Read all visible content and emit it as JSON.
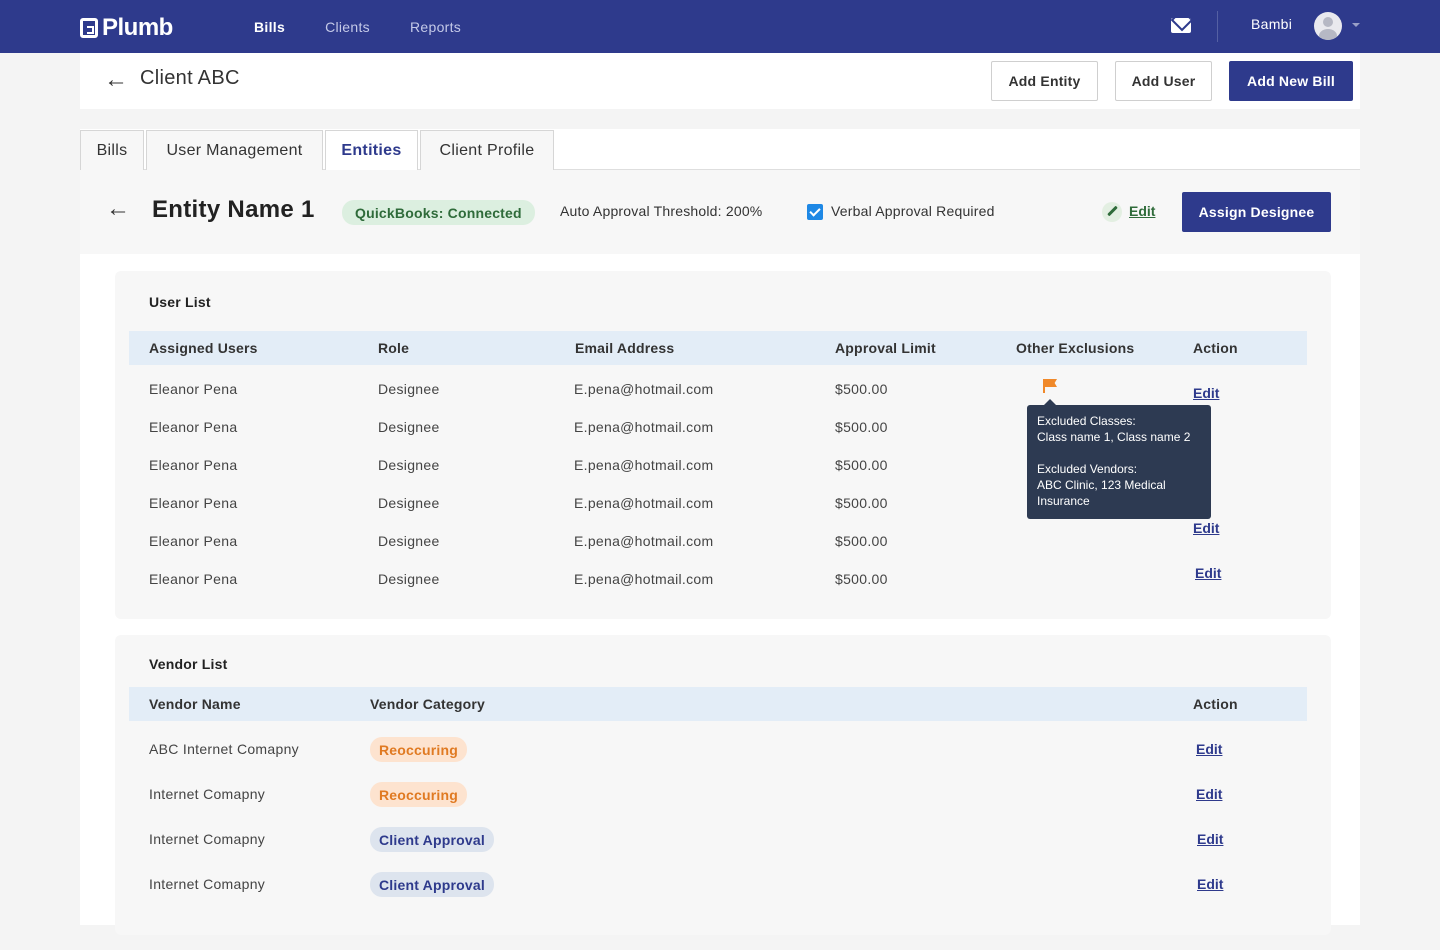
{
  "app": {
    "logo": "Plumb"
  },
  "nav": {
    "links": [
      "Bills",
      "Clients",
      "Reports"
    ],
    "active": "Bills",
    "user_name": "Bambi"
  },
  "client": {
    "title": "Client ABC",
    "add_entity": "Add Entity",
    "add_user": "Add User",
    "add_bill": "Add New Bill"
  },
  "tabs": [
    "Bills",
    "User Management",
    "Entities",
    "Client Profile"
  ],
  "entity": {
    "name": "Entity Name 1",
    "quickbooks": "QuickBooks: Connected",
    "threshold": "Auto Approval Threshold: 200%",
    "verbal_checked": true,
    "verbal": "Verbal Approval Required",
    "edit": "Edit",
    "assign": "Assign Designee"
  },
  "user_list": {
    "title": "User List",
    "headers": [
      "Assigned Users",
      "Role",
      "Email Address",
      "Approval Limit",
      "Other Exclusions",
      "Action"
    ],
    "rows": [
      {
        "name": "Eleanor Pena",
        "role": "Designee",
        "email": "E.pena@hotmail.com",
        "limit": "$500.00",
        "action": "Edit"
      },
      {
        "name": "Eleanor Pena",
        "role": "Designee",
        "email": "E.pena@hotmail.com",
        "limit": "$500.00",
        "action": "it"
      },
      {
        "name": "Eleanor Pena",
        "role": "Designee",
        "email": "E.pena@hotmail.com",
        "limit": "$500.00",
        "action": "it"
      },
      {
        "name": "Eleanor Pena",
        "role": "Designee",
        "email": "E.pena@hotmail.com",
        "limit": "$500.00",
        "action": "Edit"
      },
      {
        "name": "Eleanor Pena",
        "role": "Designee",
        "email": "E.pena@hotmail.com",
        "limit": "$500.00",
        "action": ""
      },
      {
        "name": "Eleanor Pena",
        "role": "Designee",
        "email": "E.pena@hotmail.com",
        "limit": "$500.00",
        "action": "Edit"
      }
    ],
    "tooltip": {
      "classes_label": "Excluded Classes:",
      "classes": "Class name 1, Class name 2",
      "vendors_label": "Excluded Vendors:",
      "vendors_line1": "ABC Clinic, 123 Medical",
      "vendors_line2": "Insurance"
    }
  },
  "vendor_list": {
    "title": "Vendor List",
    "headers": [
      "Vendor Name",
      "Vendor Category",
      "Action"
    ],
    "rows": [
      {
        "name": "ABC Internet Comapny",
        "category": "Reoccuring",
        "category_color": "#e07a22",
        "action": "Edit"
      },
      {
        "name": "Internet Comapny",
        "category": "Reoccuring",
        "category_color": "#e07a22",
        "action": "Edit"
      },
      {
        "name": "Internet Comapny",
        "category": "Client Approval",
        "category_color": "#2e3a8c",
        "action": "Edit"
      },
      {
        "name": "Internet Comapny",
        "category": "Client Approval",
        "category_color": "#2e3a8c",
        "action": "Edit"
      }
    ]
  },
  "colors": {
    "brand": "#2e3a8c",
    "success": "#2f6b3a",
    "warning": "#e07a22",
    "checkbox": "#1e88e5"
  }
}
